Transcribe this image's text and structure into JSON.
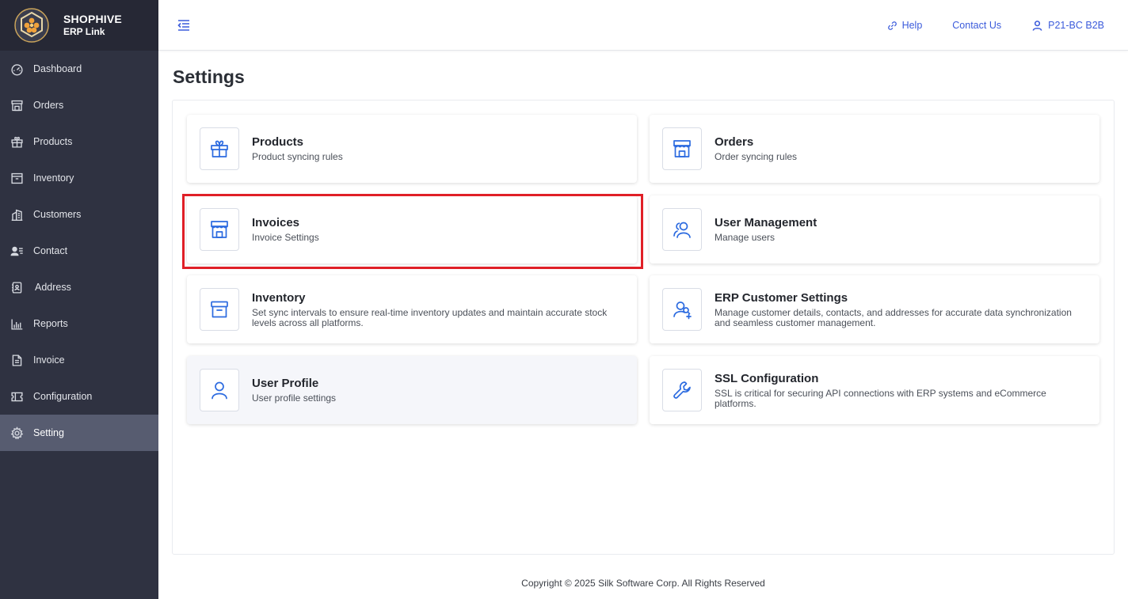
{
  "brand": {
    "name": "SHOPHIVE",
    "sub": "ERP Link"
  },
  "sidebar": {
    "items": [
      {
        "label": "Dashboard",
        "icon": "dashboard-icon"
      },
      {
        "label": "Orders",
        "icon": "store-icon"
      },
      {
        "label": "Products",
        "icon": "gift-icon"
      },
      {
        "label": "Inventory",
        "icon": "archive-icon"
      },
      {
        "label": "Customers",
        "icon": "building-icon"
      },
      {
        "label": "Contact",
        "icon": "contact-card-icon"
      },
      {
        "label": "Address",
        "icon": "address-book-icon"
      },
      {
        "label": "Reports",
        "icon": "bar-chart-icon"
      },
      {
        "label": "Invoice",
        "icon": "document-icon"
      },
      {
        "label": "Configuration",
        "icon": "ticket-icon"
      },
      {
        "label": "Setting",
        "icon": "gear-icon",
        "active": true
      }
    ]
  },
  "header": {
    "help": "Help",
    "contact": "Contact Us",
    "user": "P21-BC B2B"
  },
  "page": {
    "title": "Settings"
  },
  "cards": [
    {
      "title": "Products",
      "desc": "Product syncing rules",
      "icon": "gift-icon"
    },
    {
      "title": "Orders",
      "desc": "Order syncing rules",
      "icon": "store-icon"
    },
    {
      "title": "Invoices",
      "desc": "Invoice Settings",
      "icon": "store-icon",
      "highlighted": true
    },
    {
      "title": "User Management",
      "desc": "Manage users",
      "icon": "users-icon"
    },
    {
      "title": "Inventory",
      "desc": "Set sync intervals to ensure real-time inventory updates and maintain accurate stock levels across all platforms.",
      "icon": "archive-icon"
    },
    {
      "title": "ERP Customer Settings",
      "desc": "Manage customer details, contacts, and addresses for accurate data synchronization and seamless customer management.",
      "icon": "user-search-add-icon"
    },
    {
      "title": "User Profile",
      "desc": "User profile settings",
      "icon": "user-icon"
    },
    {
      "title": "SSL Configuration",
      "desc": "SSL is critical for securing API connections with ERP systems and eCommerce platforms.",
      "icon": "wrench-icon"
    }
  ],
  "footer": {
    "text": "Copyright © 2025 Silk Software Corp. All Rights Reserved"
  },
  "colors": {
    "accent": "#2c6be0",
    "sidebar_bg": "#2f3241",
    "highlight": "#e01f27"
  }
}
